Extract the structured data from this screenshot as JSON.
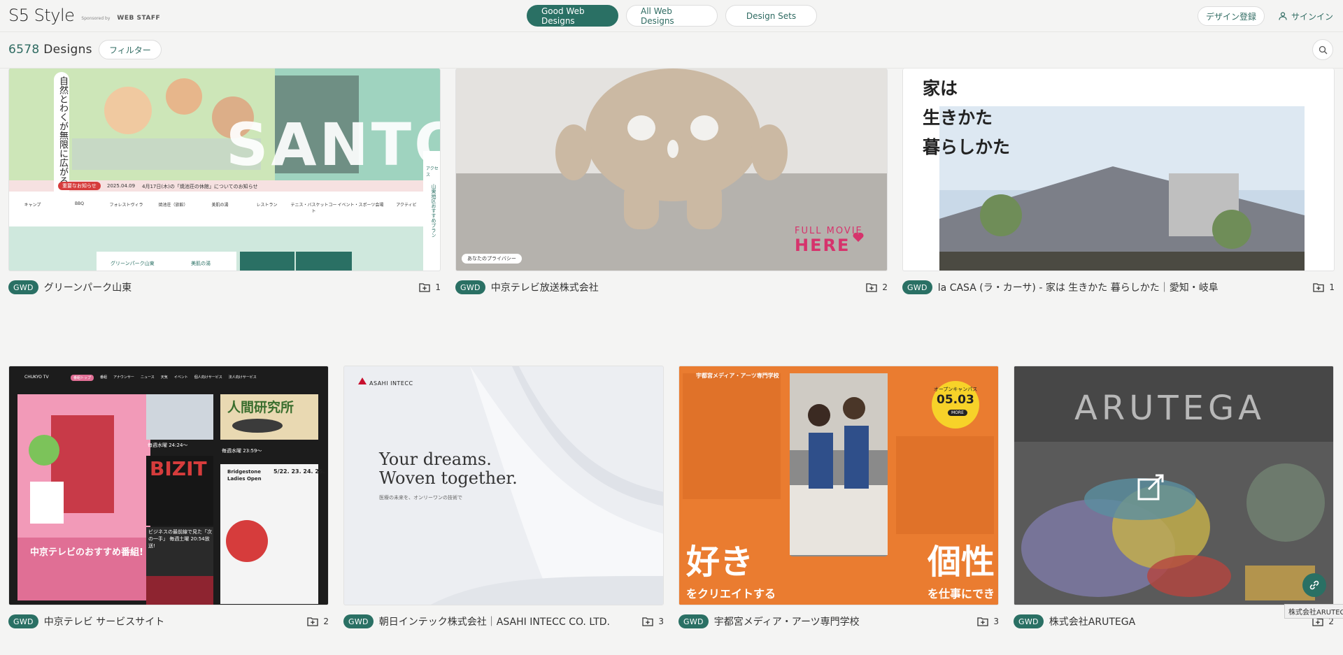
{
  "header": {
    "logo": "S5 Style",
    "sponsor_label": "Sponsored by",
    "sponsor_name": "WEB STAFF",
    "nav": [
      {
        "label": "Good Web Designs",
        "active": true
      },
      {
        "label": "All Web Designs",
        "active": false
      },
      {
        "label": "Design Sets",
        "active": false
      }
    ],
    "register_label": "デザイン登録",
    "signin_label": "サインイン"
  },
  "subbar": {
    "count": "6578",
    "count_suffix": "Designs",
    "filter_label": "フィルター"
  },
  "colors": {
    "accent": "#2a7064",
    "background": "#f4f4f3"
  },
  "cards": [
    {
      "badge": "GWD",
      "title": "グリーンパーク山東",
      "collections": "1",
      "thumb": {
        "vertical_text": "自然とわくが無限に広がる。",
        "big_text": "SANTO",
        "news_tag": "重要なお知らせ",
        "news_date": "2025.04.09",
        "news_text": "4月17日(木)の「焼池荘の休館」についてのお知らせ",
        "icons": [
          "キャンプ",
          "BBQ",
          "フォレストヴィラ",
          "焼池荘（旅館）",
          "美肌の湯",
          "レストラン",
          "テニス・バスケットコート",
          "イベント・スポーツ会場",
          "アクティビ"
        ],
        "bottom_pills": [
          "グリーンパーク山東",
          "美肌の湯"
        ],
        "side_access": "アクセス",
        "side_text": "山東地区おすすめプラン"
      }
    },
    {
      "badge": "GWD",
      "title": "中京テレビ放送株式会社",
      "collections": "2",
      "thumb": {
        "movie_line1": "FULL MOVIE",
        "movie_line2": "HERE",
        "privacy": "あなたのプライバシー"
      }
    },
    {
      "badge": "GWD",
      "title": "la CASA (ラ・カーサ) - 家は 生きかた 暮らしかた｜愛知・岐阜",
      "collections": "1",
      "thumb": {
        "lines": [
          "家は",
          "生きかた",
          "暮らしかた"
        ]
      }
    },
    {
      "badge": "GWD",
      "title": "中京テレビ サービスサイト",
      "collections": "2",
      "thumb": {
        "brand": "CHUKYO TV",
        "nav": [
          "番組トップ",
          "番組",
          "アナウンサー",
          "ニュース",
          "天気",
          "イベント",
          "個人向けサービス",
          "法人向けサービス"
        ],
        "recommend": "中京テレビのおすすめ番組!",
        "slot1": "毎週水曜 24:24〜",
        "slot2": "毎週水曜 23:59〜",
        "show1": "人間研究所",
        "show2": "BIZIT",
        "show3": "Bridgestone Ladies Open",
        "show3_dates": "5/22. 23. 24. 25.",
        "bizit_caption": "ビジネスの最前線で見た「次の一手」 毎週土曜 20:54放送!"
      }
    },
    {
      "badge": "GWD",
      "title": "朝日インテック株式会社｜ASAHI INTECC CO. LTD.",
      "collections": "3",
      "thumb": {
        "brand": "ASAHI INTECC",
        "headline1": "Your dreams.",
        "headline2": "Woven together.",
        "sub": "医療の未来を、オンリーワンの技術で"
      }
    },
    {
      "badge": "GWD",
      "title": "宇都宮メディア・アーツ専門学校",
      "collections": "3",
      "thumb": {
        "school": "宇都宮メディア・アーツ専門学校",
        "oc_label": "オープンキャンパス",
        "oc_date": "05.03",
        "more": "MORE",
        "left_big": "好き",
        "left_small": "をクリエイトする",
        "right_big": "個性",
        "right_small": "を仕事にできる"
      }
    },
    {
      "badge": "GWD",
      "title": "株式会社ARUTEGA",
      "collections": "2",
      "thumb": {
        "brand": "ARUTEGA"
      }
    }
  ],
  "tooltip": "株式会社ARUTEGA"
}
